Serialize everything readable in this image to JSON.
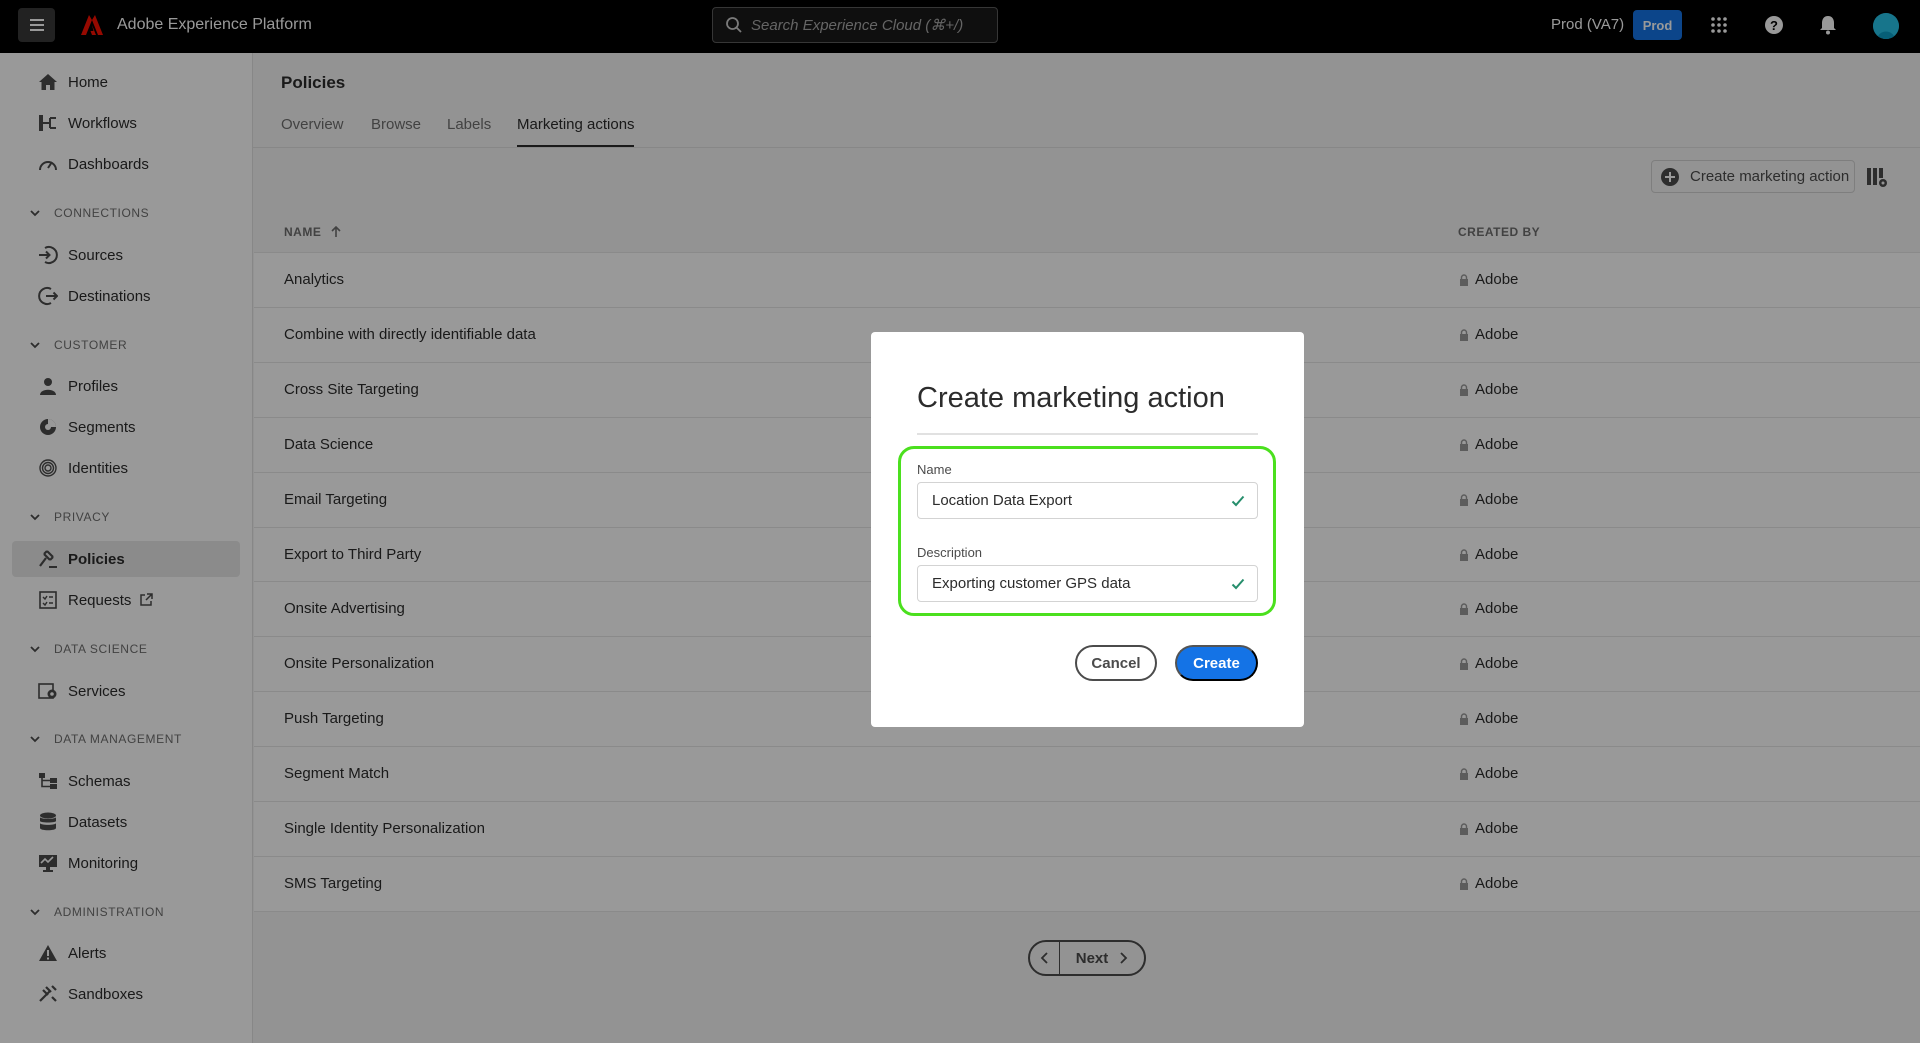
{
  "topbar": {
    "app_title": "Adobe Experience Platform",
    "search_placeholder": "Search Experience Cloud (⌘+/)",
    "org_name": "Prod (VA7)",
    "env_badge": "Prod",
    "brand_color": "#fa0f00",
    "accent_color": "#1473e6"
  },
  "sidebar": {
    "items": [
      {
        "label": "Home",
        "icon": "home-icon"
      },
      {
        "label": "Workflows",
        "icon": "workflow-icon"
      },
      {
        "label": "Dashboards",
        "icon": "dashboard-icon"
      },
      {
        "label": "Sources",
        "icon": "sources-icon"
      },
      {
        "label": "Destinations",
        "icon": "destinations-icon"
      },
      {
        "label": "Profiles",
        "icon": "profile-icon"
      },
      {
        "label": "Segments",
        "icon": "segments-icon"
      },
      {
        "label": "Identities",
        "icon": "fingerprint-icon"
      },
      {
        "label": "Policies",
        "icon": "gavel-icon"
      },
      {
        "label": "Requests",
        "icon": "requests-icon"
      },
      {
        "label": "Services",
        "icon": "services-icon"
      },
      {
        "label": "Schemas",
        "icon": "schema-icon"
      },
      {
        "label": "Datasets",
        "icon": "database-icon"
      },
      {
        "label": "Monitoring",
        "icon": "monitoring-icon"
      },
      {
        "label": "Alerts",
        "icon": "alert-icon"
      },
      {
        "label": "Sandboxes",
        "icon": "sandbox-icon"
      }
    ],
    "sections": [
      "CONNECTIONS",
      "CUSTOMER",
      "PRIVACY",
      "DATA SCIENCE",
      "DATA MANAGEMENT",
      "ADMINISTRATION"
    ]
  },
  "main": {
    "page_title": "Policies",
    "tabs": [
      "Overview",
      "Browse",
      "Labels",
      "Marketing actions"
    ],
    "active_tab": "Marketing actions",
    "create_button": "Create marketing action",
    "columns": [
      "NAME",
      "CREATED BY"
    ],
    "rows": [
      {
        "name": "Analytics",
        "created_by": "Adobe"
      },
      {
        "name": "Combine with directly identifiable data",
        "created_by": "Adobe"
      },
      {
        "name": "Cross Site Targeting",
        "created_by": "Adobe"
      },
      {
        "name": "Data Science",
        "created_by": "Adobe"
      },
      {
        "name": "Email Targeting",
        "created_by": "Adobe"
      },
      {
        "name": "Export to Third Party",
        "created_by": "Adobe"
      },
      {
        "name": "Onsite Advertising",
        "created_by": "Adobe"
      },
      {
        "name": "Onsite Personalization",
        "created_by": "Adobe"
      },
      {
        "name": "Push Targeting",
        "created_by": "Adobe"
      },
      {
        "name": "Segment Match",
        "created_by": "Adobe"
      },
      {
        "name": "Single Identity Personalization",
        "created_by": "Adobe"
      },
      {
        "name": "SMS Targeting",
        "created_by": "Adobe"
      }
    ],
    "pager_next": "Next"
  },
  "dialog": {
    "title": "Create marketing action",
    "name_label": "Name",
    "name_value": "Location Data Export",
    "description_label": "Description",
    "description_value": "Exporting customer GPS data",
    "cancel_label": "Cancel",
    "create_label": "Create",
    "highlight_color": "#4be01e"
  }
}
